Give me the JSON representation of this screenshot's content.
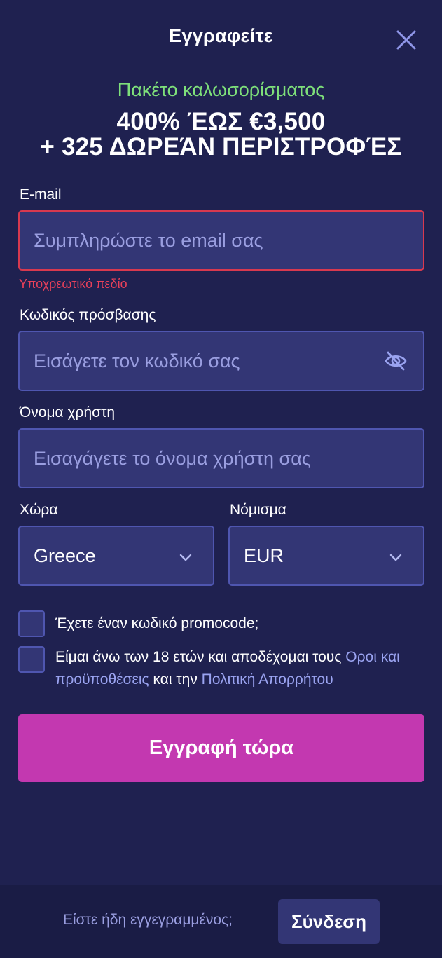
{
  "header": {
    "title": "Εγγραφείτε"
  },
  "promo": {
    "subtitle": "Πακέτο καλωσορίσματος",
    "line1": "400% ΈΩΣ €3,500",
    "line2": "+ 325 ΔΩΡΕΆΝ ΠΕΡΙΣΤΡΟΦΈΣ"
  },
  "form": {
    "email": {
      "label": "E-mail",
      "placeholder": "Συμπληρώστε το email σας",
      "error": "Υποχρεωτικό πεδίο"
    },
    "password": {
      "label": "Κωδικός πρόσβασης",
      "placeholder": "Εισάγετε τον κωδικό σας"
    },
    "username": {
      "label": "Όνομα χρήστη",
      "placeholder": "Εισαγάγετε το όνομα χρήστη σας"
    },
    "country": {
      "label": "Χώρα",
      "value": "Greece"
    },
    "currency": {
      "label": "Νόμισμα",
      "value": "EUR"
    },
    "promocode_label": "Έχετε έναν κωδικό promocode;",
    "terms": {
      "text1": "Είμαι άνω των 18 ετών και αποδέχομαι τους ",
      "link1": "Οροι και προϋποθέσεις",
      "text2": " και την ",
      "link2": "Πολιτική Απορρήτου"
    },
    "submit_label": "Εγγραφή τώρα"
  },
  "footer": {
    "text": "Είστε ήδη εγγεγραμμένος;",
    "login_label": "Σύνδεση"
  },
  "colors": {
    "background": "#1f2150",
    "field": "#333675",
    "accent": "#c338b0",
    "promo_green": "#7ee07a",
    "error": "#e8405a"
  }
}
